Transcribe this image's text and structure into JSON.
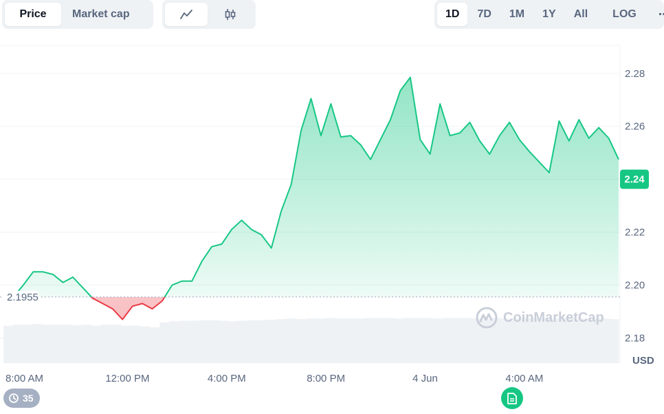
{
  "toolbar": {
    "type_tabs": [
      "Price",
      "Market cap"
    ],
    "style_icons": [
      "line-chart-icon",
      "candlestick-icon"
    ],
    "ranges": [
      "1D",
      "7D",
      "1M",
      "1Y",
      "All",
      "LOG"
    ],
    "more": "⋯",
    "selected_range": "1D",
    "selected_type": "Price",
    "selected_style": "line-chart-icon"
  },
  "watermark": "CoinMarketCap",
  "history_badge": "35",
  "colors": {
    "up": "#16c784",
    "down": "#ea3943",
    "grid": "#eff2f5",
    "volume": "#eff2f5"
  },
  "chart_data": {
    "type": "area",
    "x_tick_labels": [
      "8:00 AM",
      "12:00 PM",
      "4:00 PM",
      "8:00 PM",
      "4 Jun",
      "4:00 AM"
    ],
    "y_ticks": [
      2.18,
      2.2,
      2.22,
      2.24,
      2.26,
      2.28
    ],
    "y_unit_label": "USD",
    "ylim": [
      2.1705,
      2.2906
    ],
    "baseline": 2.1955,
    "baseline_label": "2.1955",
    "current_price": 2.24,
    "current_label": "2.24",
    "x": [
      0.0,
      0.4,
      0.8,
      1.2,
      1.6,
      2.0,
      2.4,
      2.8,
      3.2,
      3.6,
      4.0,
      4.4,
      4.8,
      5.2,
      5.6,
      6.0,
      6.4,
      6.8,
      7.2,
      7.6,
      8.0,
      8.4,
      8.8,
      9.2,
      9.6,
      10.0,
      10.4,
      10.8,
      11.2,
      11.6,
      12.0,
      12.4,
      12.8,
      13.2,
      13.6,
      14.0,
      14.4,
      14.8,
      15.2,
      15.6,
      16.0,
      16.4,
      16.8,
      17.2,
      17.6,
      18.0,
      18.4,
      18.8,
      19.2,
      19.6,
      20.0,
      20.4,
      20.8,
      21.2,
      21.6,
      22.0,
      22.4,
      22.8,
      23.2,
      23.6,
      24.0,
      24.4,
      24.8
    ],
    "y": [
      2.1965,
      2.1955,
      2.2,
      2.205,
      2.205,
      2.204,
      2.201,
      2.203,
      2.199,
      2.195,
      2.193,
      2.191,
      2.187,
      2.192,
      2.193,
      2.191,
      2.194,
      2.2,
      2.2015,
      2.2015,
      2.209,
      2.2145,
      2.2155,
      2.221,
      2.2245,
      2.221,
      2.219,
      2.214,
      2.228,
      2.238,
      2.2585,
      2.2705,
      2.2565,
      2.2685,
      2.256,
      2.2565,
      2.253,
      2.2475,
      2.255,
      2.2625,
      2.2735,
      2.2785,
      2.255,
      2.2495,
      2.2685,
      2.2565,
      2.2575,
      2.2615,
      2.2545,
      2.2495,
      2.2565,
      2.2615,
      2.255,
      2.2505,
      2.2465,
      2.2425,
      2.262,
      2.2545,
      2.2625,
      2.2555,
      2.2595,
      2.2555,
      2.2475
    ],
    "volume": [
      0.68,
      0.7,
      0.7,
      0.71,
      0.7,
      0.7,
      0.7,
      0.69,
      0.7,
      0.68,
      0.7,
      0.7,
      0.68,
      0.68,
      0.67,
      0.65,
      0.74,
      0.76,
      0.77,
      0.77,
      0.78,
      0.78,
      0.77,
      0.76,
      0.77,
      0.78,
      0.78,
      0.79,
      0.8,
      0.81,
      0.8,
      0.81,
      0.81,
      0.82,
      0.81,
      0.81,
      0.81,
      0.82,
      0.82,
      0.82,
      0.81,
      0.82,
      0.82,
      0.82,
      0.81,
      0.82,
      0.82,
      0.82,
      0.81,
      0.8,
      0.82,
      0.81,
      0.81,
      0.82,
      0.82,
      0.82,
      0.81,
      0.82,
      0.82,
      0.81,
      0.82,
      0.81,
      0.8
    ],
    "grid": true
  }
}
